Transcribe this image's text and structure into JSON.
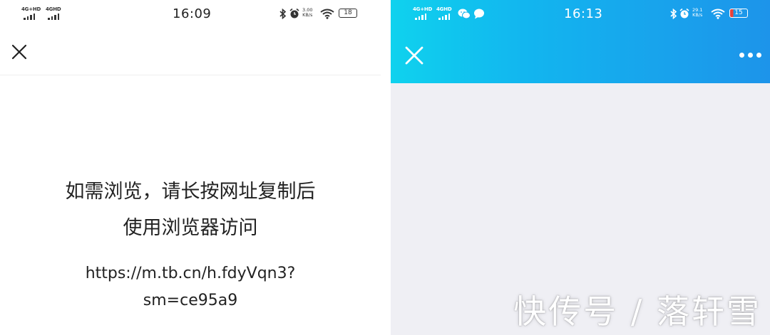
{
  "left_screen": {
    "status_bar": {
      "network_1": "4G+HD",
      "network_2": "4GHD",
      "time": "16:09",
      "speed_value": "3.00",
      "speed_unit": "KB/s",
      "battery": "18"
    },
    "message_line_1": "如需浏览，请长按网址复制后",
    "message_line_2": "使用浏览器访问",
    "url_line_1": "https://m.tb.cn/h.fdyVqn3?",
    "url_line_2": "sm=ce95a9"
  },
  "right_screen": {
    "status_bar": {
      "network_1": "4G+HD",
      "network_2": "4GHD",
      "time": "16:13",
      "speed_value": "29.1",
      "speed_unit": "KB/s",
      "battery": "15"
    },
    "accent_color": "#12b6ef",
    "background_color": "#efeff4"
  },
  "watermark": "快传号 / 落轩雪",
  "icons": {
    "close": "close-icon",
    "more": "more-dots-icon",
    "bluetooth": "bluetooth-icon",
    "alarm": "alarm-icon",
    "wifi": "wifi-icon",
    "battery": "battery-icon",
    "wechat": "wechat-icon",
    "chat": "chat-bubble-icon"
  }
}
